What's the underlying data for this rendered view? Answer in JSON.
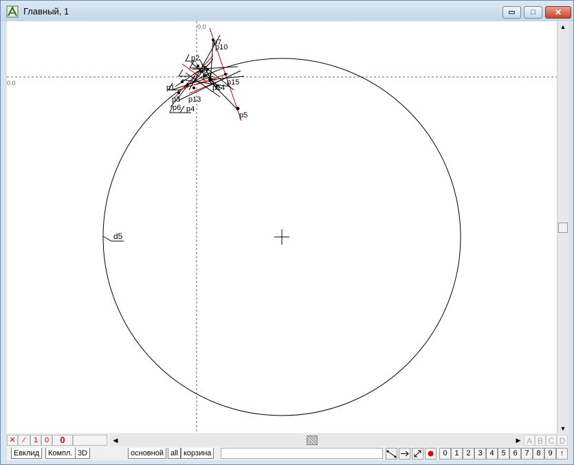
{
  "window": {
    "title": "Главный, 1",
    "controls": {
      "minimize": "▭",
      "maximize": "□",
      "close": "✕"
    }
  },
  "canvas": {
    "axis_x_origin_label": "0.0",
    "axis_y_origin_label": "0.0",
    "circle_label": "d5",
    "point_labels": [
      "p7",
      "p10",
      "p2",
      "p15",
      "p5",
      "p14",
      "p13",
      "p6",
      "p4",
      "p3",
      "p1",
      "p8",
      "p9"
    ],
    "colors": {
      "construction_line": "#cc0000",
      "geometry": "#000000",
      "axis": "#666666"
    }
  },
  "scroll": {
    "up_arrow": "▲",
    "down_arrow": "▼",
    "left_arrow": "◀",
    "right_arrow": "▶"
  },
  "status_cells": [
    "✕",
    "⁄",
    "1",
    "0",
    "0"
  ],
  "corner_buttons": [
    "A",
    "B",
    "C",
    "D"
  ],
  "tabs_left": [
    "Евклид",
    "Компл.",
    "3D"
  ],
  "tabs_right": [
    "основной",
    "all",
    "корзина"
  ],
  "tool_icons": [
    "segment-icon",
    "arrow-right-icon",
    "resize-icon",
    "record-icon"
  ],
  "number_buttons": [
    "0",
    "1",
    "2",
    "3",
    "4",
    "5",
    "6",
    "7",
    "8",
    "9",
    "↑"
  ]
}
